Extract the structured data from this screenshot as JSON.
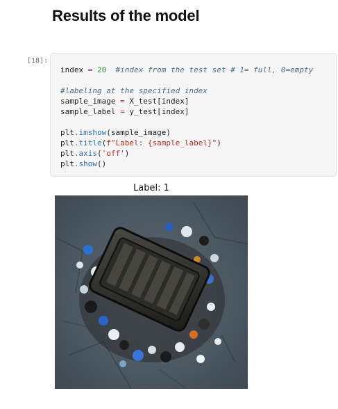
{
  "section": {
    "heading": "Results of the model"
  },
  "cell": {
    "prompt": "[18]:",
    "code_lines": [
      [
        {
          "t": "index ",
          "c": "var"
        },
        {
          "t": "=",
          "c": "op"
        },
        {
          "t": " ",
          "c": "var"
        },
        {
          "t": "20",
          "c": "num"
        },
        {
          "t": "  ",
          "c": "var"
        },
        {
          "t": "#index from the test set # 1= full, 0=empty",
          "c": "cmt"
        }
      ],
      [],
      [
        {
          "t": "#labeling at the specified index",
          "c": "cmt"
        }
      ],
      [
        {
          "t": "sample_image ",
          "c": "var"
        },
        {
          "t": "=",
          "c": "op"
        },
        {
          "t": " X_test[index]",
          "c": "var"
        }
      ],
      [
        {
          "t": "sample_label ",
          "c": "var"
        },
        {
          "t": "=",
          "c": "op"
        },
        {
          "t": " y_test[index]",
          "c": "var"
        }
      ],
      [],
      [
        {
          "t": "plt",
          "c": "var"
        },
        {
          "t": ".",
          "c": "op"
        },
        {
          "t": "imshow",
          "c": "fn"
        },
        {
          "t": "(sample_image)",
          "c": "var"
        }
      ],
      [
        {
          "t": "plt",
          "c": "var"
        },
        {
          "t": ".",
          "c": "op"
        },
        {
          "t": "title",
          "c": "fn"
        },
        {
          "t": "(",
          "c": "var"
        },
        {
          "t": "f\"Label: {sample_label}\"",
          "c": "str"
        },
        {
          "t": ")",
          "c": "var"
        }
      ],
      [
        {
          "t": "plt",
          "c": "var"
        },
        {
          "t": ".",
          "c": "op"
        },
        {
          "t": "axis",
          "c": "fn"
        },
        {
          "t": "(",
          "c": "var"
        },
        {
          "t": "'off'",
          "c": "str"
        },
        {
          "t": ")",
          "c": "var"
        }
      ],
      [
        {
          "t": "plt",
          "c": "var"
        },
        {
          "t": ".",
          "c": "op"
        },
        {
          "t": "show",
          "c": "fn"
        },
        {
          "t": "()",
          "c": "var"
        }
      ]
    ]
  },
  "output": {
    "title": "Label: 1",
    "image_semantic": "trash-pile-photo"
  },
  "colors": {
    "cell_background": "#f6f6f7",
    "number": "#3b8a3b",
    "operator": "#a2307a",
    "comment": "#4a6f86",
    "function": "#2a6fb0",
    "string": "#b22d22"
  }
}
